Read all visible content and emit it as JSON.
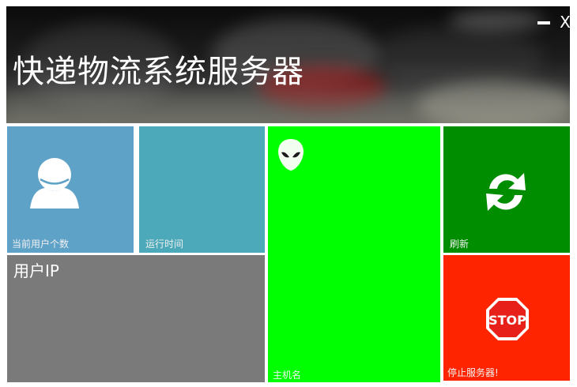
{
  "window": {
    "title": "快递物流系统服务器",
    "minimize_icon": "minimize-icon",
    "close_label": "X"
  },
  "tiles": {
    "users": {
      "label": "当前用户个数",
      "icon": "user-icon",
      "color": "#5fa2c8"
    },
    "uptime": {
      "label": "运行时间",
      "color": "#4ba9b9"
    },
    "host": {
      "label": "主机名",
      "icon": "alien-icon",
      "color": "#00ff00"
    },
    "refresh": {
      "label": "刷新",
      "icon": "refresh-icon",
      "color": "#008d00"
    },
    "ip": {
      "title": "用户IP",
      "color": "#7a7a7a"
    },
    "stop": {
      "label": "停止服务器!",
      "icon": "stop-sign-icon",
      "sign_text": "STOP",
      "color": "#ff2400"
    }
  }
}
